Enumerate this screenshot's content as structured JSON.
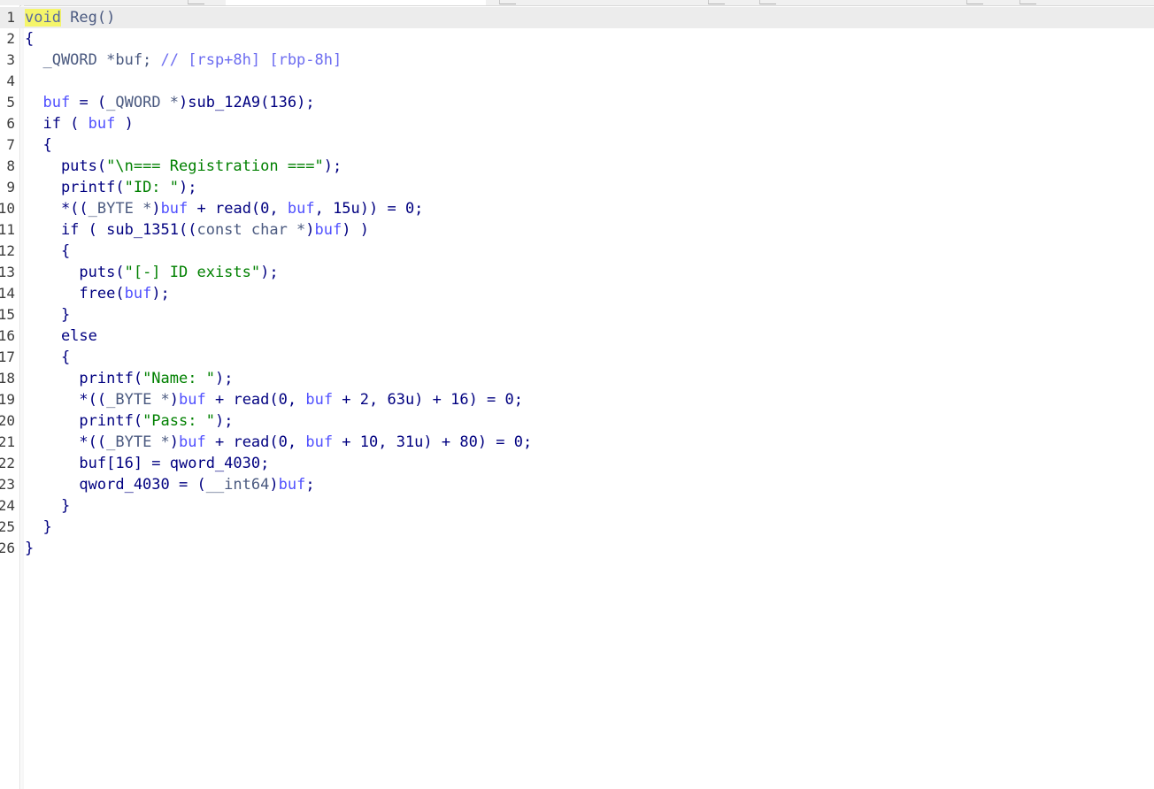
{
  "editor": {
    "lines": [
      {
        "num": "1",
        "tokens": [
          {
            "t": "void",
            "c": "hl"
          },
          {
            "t": " Reg()",
            "c": "type"
          }
        ]
      },
      {
        "num": "2",
        "tokens": [
          {
            "t": "{",
            "c": "kw"
          }
        ]
      },
      {
        "num": "3",
        "tokens": [
          {
            "t": "  _QWORD *buf; ",
            "c": "type"
          },
          {
            "t": "// [rsp+8h] [rbp-8h]",
            "c": "cmt"
          }
        ]
      },
      {
        "num": "4",
        "tokens": []
      },
      {
        "num": "5",
        "tokens": [
          {
            "t": "  ",
            "c": "kw"
          },
          {
            "t": "buf",
            "c": "var"
          },
          {
            "t": " = (",
            "c": "kw"
          },
          {
            "t": "_QWORD *",
            "c": "type"
          },
          {
            "t": ")sub_12A9(136);",
            "c": "kw"
          }
        ]
      },
      {
        "num": "6",
        "tokens": [
          {
            "t": "  if ( ",
            "c": "kw"
          },
          {
            "t": "buf",
            "c": "var"
          },
          {
            "t": " )",
            "c": "kw"
          }
        ]
      },
      {
        "num": "7",
        "tokens": [
          {
            "t": "  {",
            "c": "kw"
          }
        ]
      },
      {
        "num": "8",
        "tokens": [
          {
            "t": "    puts(",
            "c": "kw"
          },
          {
            "t": "\"\\n=== Registration ===\"",
            "c": "str"
          },
          {
            "t": ");",
            "c": "kw"
          }
        ]
      },
      {
        "num": "9",
        "tokens": [
          {
            "t": "    printf(",
            "c": "kw"
          },
          {
            "t": "\"ID: \"",
            "c": "str"
          },
          {
            "t": ");",
            "c": "kw"
          }
        ]
      },
      {
        "num": "10",
        "tokens": [
          {
            "t": "    *((",
            "c": "kw"
          },
          {
            "t": "_BYTE *",
            "c": "type"
          },
          {
            "t": ")",
            "c": "kw"
          },
          {
            "t": "buf",
            "c": "var"
          },
          {
            "t": " + read(0, ",
            "c": "kw"
          },
          {
            "t": "buf",
            "c": "var"
          },
          {
            "t": ", 15u)) = 0;",
            "c": "kw"
          }
        ]
      },
      {
        "num": "11",
        "tokens": [
          {
            "t": "    if ( sub_1351((",
            "c": "kw"
          },
          {
            "t": "const char *",
            "c": "type"
          },
          {
            "t": ")",
            "c": "kw"
          },
          {
            "t": "buf",
            "c": "var"
          },
          {
            "t": ") )",
            "c": "kw"
          }
        ]
      },
      {
        "num": "12",
        "tokens": [
          {
            "t": "    {",
            "c": "kw"
          }
        ]
      },
      {
        "num": "13",
        "tokens": [
          {
            "t": "      puts(",
            "c": "kw"
          },
          {
            "t": "\"[-] ID exists\"",
            "c": "str"
          },
          {
            "t": ");",
            "c": "kw"
          }
        ]
      },
      {
        "num": "14",
        "tokens": [
          {
            "t": "      free(",
            "c": "kw"
          },
          {
            "t": "buf",
            "c": "var"
          },
          {
            "t": ");",
            "c": "kw"
          }
        ]
      },
      {
        "num": "15",
        "tokens": [
          {
            "t": "    }",
            "c": "kw"
          }
        ]
      },
      {
        "num": "16",
        "tokens": [
          {
            "t": "    else",
            "c": "kw"
          }
        ]
      },
      {
        "num": "17",
        "tokens": [
          {
            "t": "    {",
            "c": "kw"
          }
        ]
      },
      {
        "num": "18",
        "tokens": [
          {
            "t": "      printf(",
            "c": "kw"
          },
          {
            "t": "\"Name: \"",
            "c": "str"
          },
          {
            "t": ");",
            "c": "kw"
          }
        ]
      },
      {
        "num": "19",
        "tokens": [
          {
            "t": "      *((",
            "c": "kw"
          },
          {
            "t": "_BYTE *",
            "c": "type"
          },
          {
            "t": ")",
            "c": "kw"
          },
          {
            "t": "buf",
            "c": "var"
          },
          {
            "t": " + read(0, ",
            "c": "kw"
          },
          {
            "t": "buf",
            "c": "var"
          },
          {
            "t": " + 2, 63u) + 16) = 0;",
            "c": "kw"
          }
        ]
      },
      {
        "num": "20",
        "tokens": [
          {
            "t": "      printf(",
            "c": "kw"
          },
          {
            "t": "\"Pass: \"",
            "c": "str"
          },
          {
            "t": ");",
            "c": "kw"
          }
        ]
      },
      {
        "num": "21",
        "tokens": [
          {
            "t": "      *((",
            "c": "kw"
          },
          {
            "t": "_BYTE *",
            "c": "type"
          },
          {
            "t": ")",
            "c": "kw"
          },
          {
            "t": "buf",
            "c": "var"
          },
          {
            "t": " + read(0, ",
            "c": "kw"
          },
          {
            "t": "buf",
            "c": "var"
          },
          {
            "t": " + 10, 31u) + 80) = 0;",
            "c": "kw"
          }
        ]
      },
      {
        "num": "22",
        "tokens": [
          {
            "t": "      buf[16] = qword_4030;",
            "c": "kw"
          }
        ]
      },
      {
        "num": "23",
        "tokens": [
          {
            "t": "      qword_4030 = (",
            "c": "kw"
          },
          {
            "t": "__int64",
            "c": "type"
          },
          {
            "t": ")",
            "c": "kw"
          },
          {
            "t": "buf",
            "c": "var"
          },
          {
            "t": ";",
            "c": "kw"
          }
        ]
      },
      {
        "num": "24",
        "tokens": [
          {
            "t": "    }",
            "c": "kw"
          }
        ]
      },
      {
        "num": "25",
        "tokens": [
          {
            "t": "  }",
            "c": "kw"
          }
        ]
      },
      {
        "num": "26",
        "tokens": [
          {
            "t": "}",
            "c": "kw"
          }
        ]
      }
    ]
  }
}
